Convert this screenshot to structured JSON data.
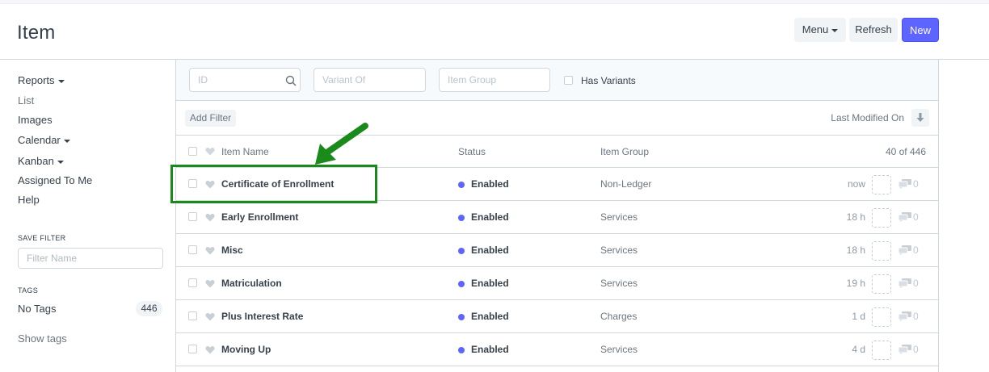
{
  "page": {
    "title": "Item"
  },
  "toolbar": {
    "menu_label": "Menu",
    "refresh_label": "Refresh",
    "new_label": "New"
  },
  "sidebar": {
    "items": [
      {
        "label": "Reports",
        "dropdown": true
      },
      {
        "label": "List",
        "dropdown": false
      },
      {
        "label": "Images",
        "dropdown": false
      },
      {
        "label": "Calendar",
        "dropdown": true
      },
      {
        "label": "Kanban",
        "dropdown": true
      },
      {
        "label": "Assigned To Me",
        "dropdown": false
      },
      {
        "label": "Help",
        "dropdown": false
      }
    ],
    "save_filter_heading": "SAVE FILTER",
    "filter_name_placeholder": "Filter Name",
    "tags_heading": "TAGS",
    "no_tags_label": "No Tags",
    "no_tags_count": "446",
    "show_tags_label": "Show tags"
  },
  "filters": {
    "id_placeholder": "ID",
    "variant_of_placeholder": "Variant Of",
    "item_group_placeholder": "Item Group",
    "has_variants_label": "Has Variants",
    "add_filter_label": "Add Filter",
    "sort_label": "Last Modified On"
  },
  "list": {
    "columns": {
      "name": "Item Name",
      "status": "Status",
      "group": "Item Group",
      "count": "40 of 446"
    },
    "rows": [
      {
        "name": "Certificate of Enrollment",
        "status": "Enabled",
        "group": "Non-Ledger",
        "time": "now",
        "comments": "0"
      },
      {
        "name": "Early Enrollment",
        "status": "Enabled",
        "group": "Services",
        "time": "18 h",
        "comments": "0"
      },
      {
        "name": "Misc",
        "status": "Enabled",
        "group": "Services",
        "time": "18 h",
        "comments": "0"
      },
      {
        "name": "Matriculation",
        "status": "Enabled",
        "group": "Services",
        "time": "19 h",
        "comments": "0"
      },
      {
        "name": "Plus Interest Rate",
        "status": "Enabled",
        "group": "Charges",
        "time": "1 d",
        "comments": "0"
      },
      {
        "name": "Moving Up",
        "status": "Enabled",
        "group": "Services",
        "time": "4 d",
        "comments": "0"
      }
    ]
  },
  "colors": {
    "accent": "#5e64ff",
    "highlight": "#1a8a1a",
    "status_enabled": "#5e64ff"
  }
}
